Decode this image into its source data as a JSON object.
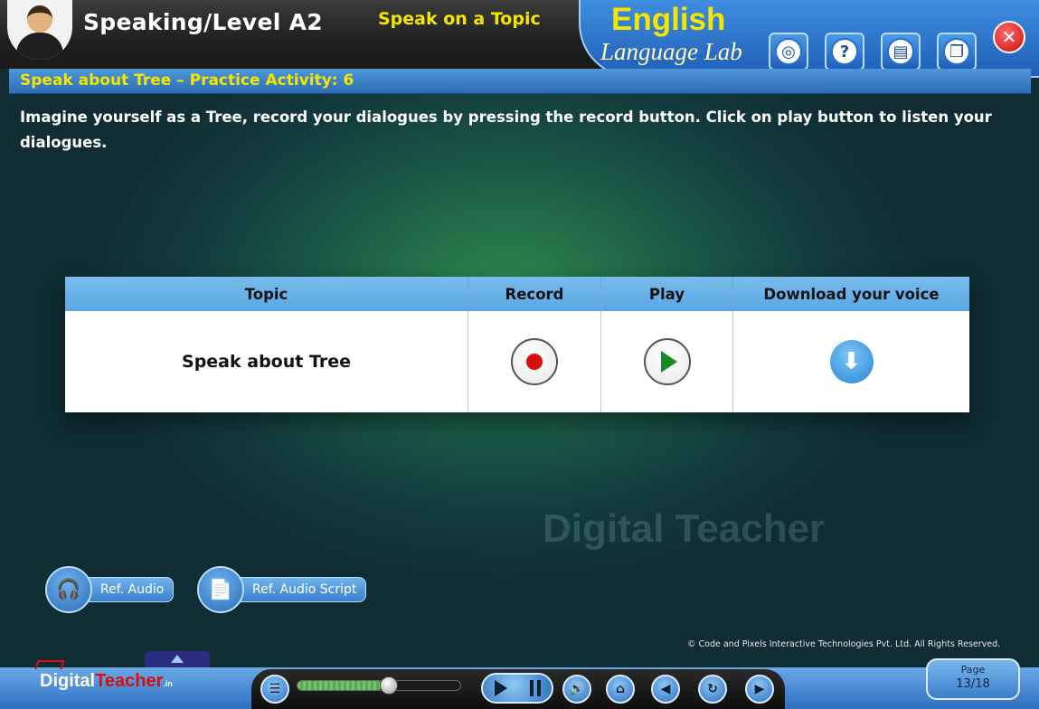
{
  "header": {
    "level_title": "Speaking/Level A2",
    "topic_title": "Speak on a Topic",
    "brand_line1": "English",
    "brand_line2": "Language Lab",
    "tools": [
      {
        "icon": "camera-icon",
        "glyph": "◎"
      },
      {
        "icon": "help-icon",
        "glyph": "?"
      },
      {
        "icon": "dictionary-icon",
        "glyph": "▤"
      },
      {
        "icon": "window-icon",
        "glyph": "❐"
      }
    ],
    "close_glyph": "✕"
  },
  "activity": {
    "title": "Speak about Tree – Practice Activity: 6",
    "instructions": "Imagine yourself as a Tree, record your dialogues by pressing the record button. Click on play button to listen your dialogues."
  },
  "table": {
    "headers": [
      "Topic",
      "Record",
      "Play",
      "Download your voice"
    ],
    "row": {
      "topic": "Speak about Tree",
      "download_glyph": "⬇"
    }
  },
  "watermark": "Digital Teacher",
  "ref_buttons": {
    "audio_label": "Ref. Audio",
    "audio_glyph": "🎧",
    "script_label": "Ref. Audio Script",
    "script_glyph": "📄"
  },
  "copyright": "© Code and Pixels Interactive Technologies Pvt. Ltd. All Rights Reserved.",
  "logo": {
    "digital": "Digital",
    "teacher": "Teacher",
    "suffix": ".in"
  },
  "controls": {
    "progress_fraction": 0.52,
    "menu_glyph": "☰",
    "volume_glyph": "🔊",
    "home_glyph": "⌂",
    "prev_glyph": "◀",
    "replay_glyph": "↻",
    "next_glyph": "▶"
  },
  "page": {
    "label": "Page",
    "value": "13/18"
  }
}
